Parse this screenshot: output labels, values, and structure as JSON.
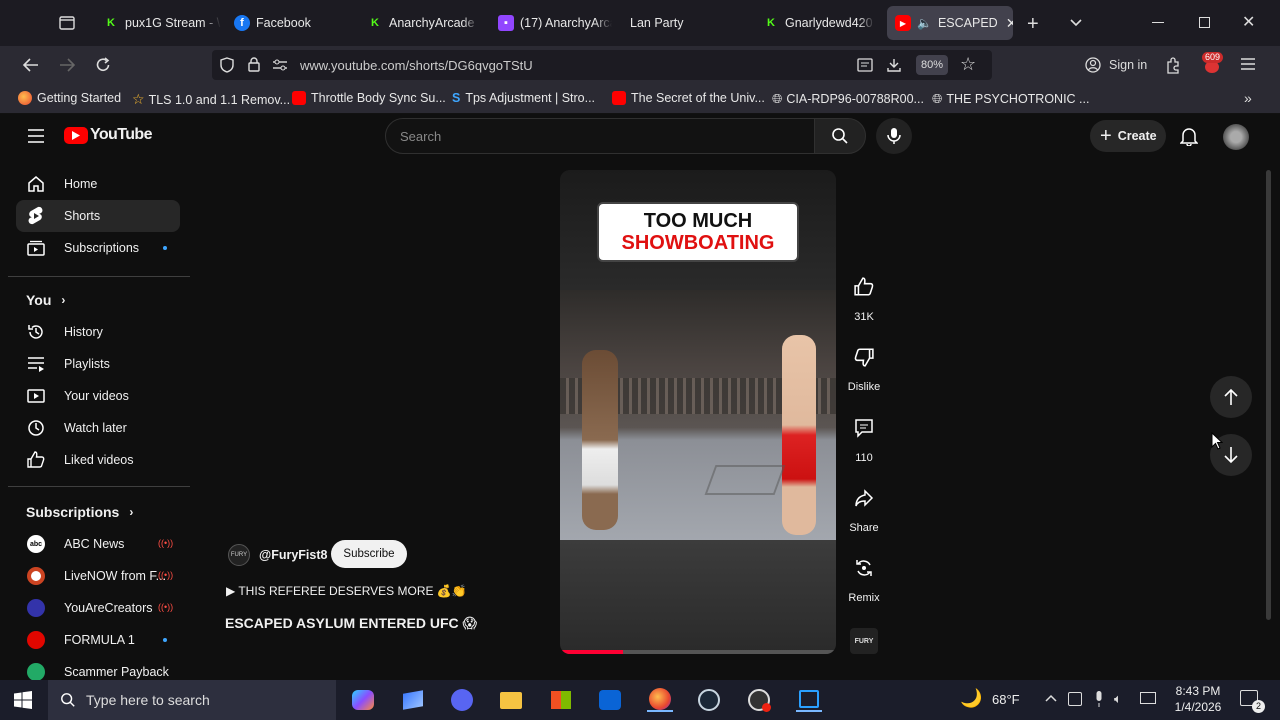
{
  "browser": {
    "tabs": [
      {
        "label": "pux1G Stream - \\",
        "icon": "kick-icon"
      },
      {
        "label": "Facebook",
        "icon": "facebook-icon"
      },
      {
        "label": "AnarchyArcade S",
        "icon": "kick-icon"
      },
      {
        "label": "(17) AnarchyArca",
        "icon": "twitch-icon"
      },
      {
        "label": "Lan Party",
        "icon": "none"
      },
      {
        "label": "Gnarlydewd420 S",
        "icon": "kick-icon"
      },
      {
        "label": "ESCAPED",
        "icon": "youtube-icon",
        "active": true
      }
    ],
    "url": "www.youtube.com/shorts/DG6qvgoTStU",
    "zoom": "80%",
    "sign_in": "Sign in",
    "badge": "609",
    "bookmarks": [
      "Getting Started",
      "TLS 1.0 and 1.1 Remov...",
      "Throttle Body Sync Su...",
      "Tps Adjustment | Stro...",
      "The Secret of the Univ...",
      "CIA-RDP96-00788R00...",
      "THE PSYCHOTRONIC ..."
    ]
  },
  "youtube": {
    "logo": "YouTube",
    "search_placeholder": "Search",
    "create": "Create",
    "sidebar": {
      "main": [
        "Home",
        "Shorts",
        "Subscriptions"
      ],
      "you_header": "You",
      "you": [
        "History",
        "Playlists",
        "Your videos",
        "Watch later",
        "Liked videos"
      ],
      "subs_header": "Subscriptions",
      "subs": [
        "ABC News",
        "LiveNOW from F...",
        "YouAreCreators",
        "FORMULA 1",
        "Scammer Payback"
      ]
    },
    "short": {
      "overlay_line1": "TOO MUCH",
      "overlay_line2": "SHOWBOATING",
      "channel": "@FuryFist8",
      "subscribe": "Subscribe",
      "description": "▶ THIS REFEREE DESERVES MORE 💰👏",
      "title": "ESCAPED ASYLUM ENTERED UFC 😱",
      "likes": "31K",
      "dislike": "Dislike",
      "comments": "110",
      "share": "Share",
      "remix": "Remix",
      "progress": 0.23
    }
  },
  "taskbar": {
    "search_placeholder": "Type here to search",
    "weather": "68°F",
    "time": "8:43 PM",
    "date": "1/4/2026",
    "notifications": "2"
  }
}
